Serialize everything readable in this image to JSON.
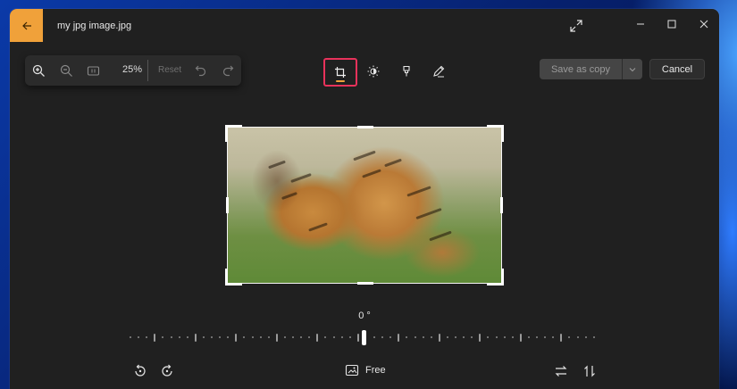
{
  "window": {
    "title": "my jpg image.jpg",
    "accent_color": "#f0a13a"
  },
  "toolbar": {
    "zoom_level": "25%",
    "reset_label": "Reset",
    "icons": [
      "zoom-in-icon",
      "zoom-out-icon",
      "fit-to-window-icon",
      "undo-icon",
      "redo-icon"
    ]
  },
  "tools": {
    "active": "crop",
    "items": [
      "crop",
      "adjust",
      "filter",
      "markup"
    ],
    "highlight_color": "#e8325b"
  },
  "actions": {
    "save_label": "Save as copy",
    "cancel_label": "Cancel"
  },
  "crop": {
    "angle": "0 °",
    "aspect_label": "Free"
  }
}
